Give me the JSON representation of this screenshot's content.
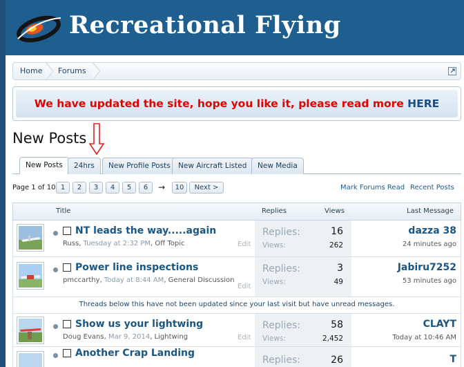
{
  "site": {
    "title": "Recreational Flying"
  },
  "breadcrumb": {
    "home": "Home",
    "forums": "Forums"
  },
  "notice": {
    "text": "We have updated the site, hope you like it, please read more ",
    "link": "HERE"
  },
  "page": {
    "title": "New Posts"
  },
  "tabs": [
    {
      "label": "New Posts",
      "active": true
    },
    {
      "label": "24hrs"
    },
    {
      "label": "New Profile Posts"
    },
    {
      "label": "New Aircraft Listed"
    },
    {
      "label": "New Media"
    }
  ],
  "pagination": {
    "label": "Page 1 of 10",
    "pages": [
      "1",
      "2",
      "3",
      "4",
      "5",
      "6"
    ],
    "arrow": "→",
    "last": "10",
    "next": "Next >"
  },
  "links": {
    "mark_read": "Mark Forums Read",
    "recent": "Recent Posts"
  },
  "columns": {
    "title": "Title",
    "replies": "Replies",
    "views": "Views",
    "last": "Last Message"
  },
  "threads": [
    {
      "title": "NT leads the way.....again",
      "author": "Russ",
      "date": "Tuesday at 2:32 PM",
      "forum": "Off Topic",
      "edit": "Edit",
      "replies_label": "Replies:",
      "replies": "16",
      "views_label": "Views:",
      "views": "262",
      "last_user": "dazza 38",
      "last_time": "24 minutes ago"
    },
    {
      "title": "Power line inspections",
      "author": "pmccarthy",
      "date": "Today at 8:44 AM",
      "forum": "General Discussion",
      "edit": "Edit",
      "replies_label": "Replies:",
      "replies": "3",
      "views_label": "Views:",
      "views": "49",
      "last_user": "Jabiru7252",
      "last_time": "53 minutes ago"
    },
    {
      "title": "Show us your lightwing",
      "author": "Doug Evans",
      "date": "Mar 9, 2014",
      "forum": "Lightwing",
      "edit": "Edit",
      "replies_label": "Replies:",
      "replies": "58",
      "views_label": "Views:",
      "views": "2,452",
      "last_user": "CLAYT",
      "last_time": "Today at 10:46 AM"
    },
    {
      "title": "Another Crap Landing",
      "replies_label": "Replies:",
      "replies": "26",
      "last_user": "T"
    }
  ],
  "separator": {
    "text": "Threads below this have not been updated since your last visit but have unread messages."
  }
}
